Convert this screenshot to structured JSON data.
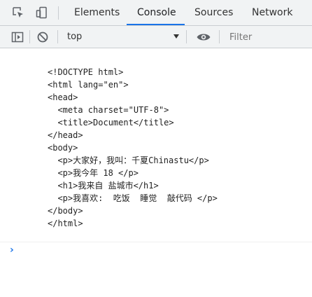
{
  "tabs": [
    {
      "label": "Elements"
    },
    {
      "label": "Console"
    },
    {
      "label": "Sources"
    },
    {
      "label": "Network"
    }
  ],
  "active_tab": "Console",
  "toolbar": {
    "context": "top",
    "filter_placeholder": "Filter"
  },
  "console_output": {
    "lines": [
      "<!DOCTYPE html>",
      "<html lang=\"en\">",
      "<head>",
      "  <meta charset=\"UTF-8\">",
      "  <title>Document</title>",
      "</head>",
      "<body>",
      "  <p>大家好，我叫：千夏Chinastu</p>",
      "  <p>我今年 18 </p>",
      "  <h1>我来自 盐城市</h1>",
      "  <p>我喜欢:  吃饭  睡觉  敲代码 </p>",
      "</body>",
      "</html>"
    ]
  },
  "prompt_symbol": "›",
  "icons": {
    "inspect": "inspect-element-icon",
    "device": "device-toolbar-icon",
    "sidebar": "show-sidebar-icon",
    "clear": "clear-console-icon",
    "eye": "live-expression-icon"
  },
  "colors": {
    "accent": "#1a73e8",
    "toolbar_bg": "#f1f3f4"
  }
}
